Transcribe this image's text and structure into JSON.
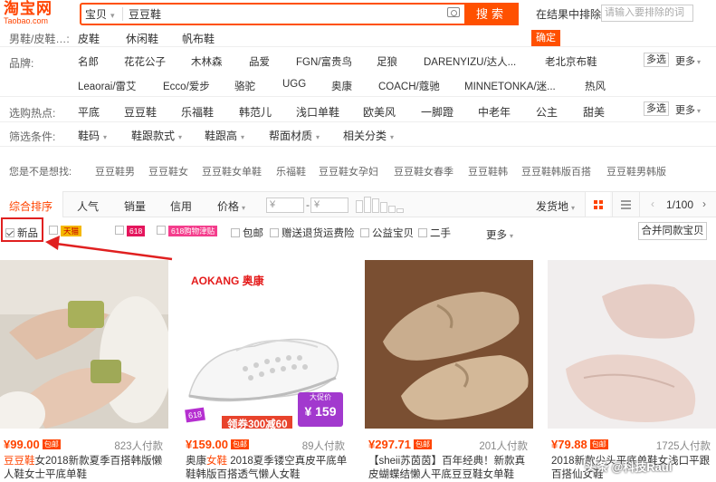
{
  "header": {
    "logo_cn": "淘宝网",
    "logo_en": "Taobao.com",
    "search_category": "宝贝",
    "search_value": "豆豆鞋",
    "search_button": "搜索",
    "exclude_label": "在结果中排除",
    "exclude_placeholder": "请输入要排除的词",
    "confirm_button": "确定"
  },
  "attrs": {
    "category_label": "男鞋/皮鞋…:",
    "category_opts": [
      "皮鞋",
      "休闲鞋",
      "帆布鞋"
    ],
    "brand_label": "品牌:",
    "brands_row1": [
      "名郎",
      "花花公子",
      "木林森",
      "品爱",
      "FGN/富贵鸟",
      "足狼",
      "DARENYIZU/达人...",
      "老北京布鞋"
    ],
    "brands_row2": [
      "Leaorai/雷艾",
      "Ecco/爱步",
      "骆驼",
      "UGG",
      "奥康",
      "COACH/蔻驰",
      "MINNETONKA/迷...",
      "热风"
    ],
    "multi_button": "多选",
    "more_link": "更多",
    "hot_label": "选购热点:",
    "hot_opts": [
      "平底",
      "豆豆鞋",
      "乐福鞋",
      "韩范儿",
      "浅口单鞋",
      "欧美风",
      "一脚蹬",
      "中老年",
      "公主",
      "甜美"
    ],
    "filter_label": "筛选条件:",
    "filter_opts": [
      "鞋码",
      "鞋跟款式",
      "鞋跟高",
      "帮面材质",
      "相关分类"
    ]
  },
  "suggest": {
    "label": "您是不是想找:",
    "items": [
      "豆豆鞋男",
      "豆豆鞋女",
      "豆豆鞋女单鞋",
      "乐福鞋",
      "豆豆鞋女孕妇",
      "豆豆鞋女春季",
      "豆豆鞋韩",
      "豆豆鞋韩版百搭",
      "豆豆鞋男韩版"
    ]
  },
  "sortbar": {
    "items": [
      "综合排序",
      "人气",
      "销量",
      "信用",
      "价格"
    ],
    "price_from": "¥",
    "price_to": "¥",
    "ship_from": "发货地",
    "pager": "1/100"
  },
  "filters": {
    "new": "新品",
    "tag_tmall": "天猫",
    "tag_618": "618",
    "tag_618_coupon": "618购物津贴",
    "free_ship": "包邮",
    "return_ins": "赠送退货运费险",
    "charity": "公益宝贝",
    "secondhand": "二手",
    "more": "更多",
    "merge": "合并同款宝贝"
  },
  "products": [
    {
      "price": "¥99.00",
      "tag": "包邮",
      "sales": "823人付款",
      "title_hl": "豆豆鞋",
      "title": "女2018新款夏季百搭韩版懒人鞋女士平底单鞋"
    },
    {
      "price": "¥159.00",
      "tag": "包邮",
      "sales": "89人付款",
      "title_pre": "奥康",
      "title_hl": "女鞋",
      "title": " 2018夏季镂空真皮平底单鞋韩版百搭透气懒人女鞋",
      "brand": "AOKANG 奥康",
      "promo": "领券300减60",
      "promo_tag": "618",
      "badge_label": "大促价",
      "badge_price": "¥ 159"
    },
    {
      "price": "¥297.71",
      "tag": "包邮",
      "sales": "201人付款",
      "title": "【sheii苏茵茵】百年经典！新款真皮蝴蝶结懒人平底豆豆鞋女单鞋"
    },
    {
      "price": "¥79.88",
      "tag": "包邮",
      "sales": "1725人付款",
      "title": "2018新款尖头平底单鞋女浅口平跟百搭仙女鞋"
    }
  ],
  "watermark": "头条 @科技Raul"
}
